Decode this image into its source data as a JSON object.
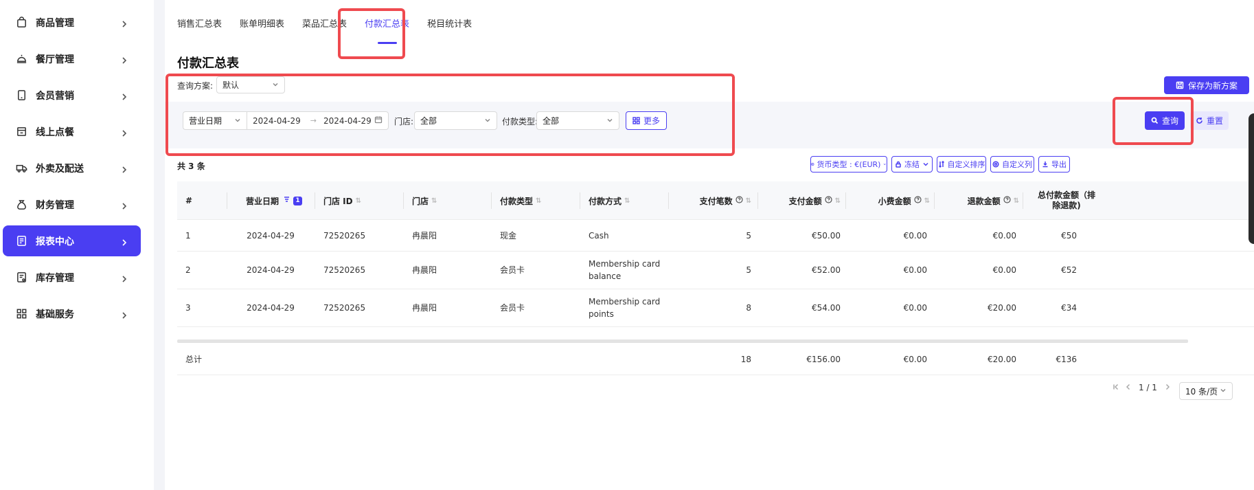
{
  "sidebar": {
    "items": [
      {
        "label": "商品管理"
      },
      {
        "label": "餐厅管理"
      },
      {
        "label": "会员营销"
      },
      {
        "label": "线上点餐"
      },
      {
        "label": "外卖及配送"
      },
      {
        "label": "财务管理"
      },
      {
        "label": "报表中心"
      },
      {
        "label": "库存管理"
      },
      {
        "label": "基础服务"
      }
    ]
  },
  "tabs": [
    {
      "label": "销售汇总表"
    },
    {
      "label": "账单明细表"
    },
    {
      "label": "菜品汇总表"
    },
    {
      "label": "付款汇总表"
    },
    {
      "label": "税目统计表"
    }
  ],
  "page": {
    "title": "付款汇总表",
    "scheme_label": "查询方案:",
    "scheme_value": "默认",
    "save_scheme": "保存为新方案"
  },
  "filters": {
    "date_type": "营业日期",
    "date_start": "2024-04-29",
    "date_end": "2024-04-29",
    "date_arrow": "→",
    "store_label": "门店:",
    "store_value": "全部",
    "pay_type_label": "付款类型:",
    "pay_type_value": "全部",
    "more": "更多",
    "query": "查询",
    "reset": "重置"
  },
  "summary": {
    "count": "共 3 条"
  },
  "toolbar": {
    "currency": "货币类型 : €(EUR)",
    "freeze": "冻结",
    "sort": "自定义排序",
    "columns": "自定义列",
    "export": "导出"
  },
  "table": {
    "headers": [
      "#",
      "营业日期",
      "门店 ID",
      "门店",
      "付款类型",
      "付款方式",
      "支付笔数",
      "支付金额",
      "小费金额",
      "退款金额",
      "总付款金额（排除退款)"
    ],
    "sort_badge": "1",
    "rows": [
      {
        "idx": "1",
        "date": "2024-04-29",
        "store_id": "72520265",
        "store": "冉晨阳",
        "pay_type": "现金",
        "pay_method_1": "Cash",
        "pay_method_2": "",
        "count": "5",
        "amount": "€50.00",
        "tip": "€0.00",
        "refund": "€0.00",
        "total": "€50"
      },
      {
        "idx": "2",
        "date": "2024-04-29",
        "store_id": "72520265",
        "store": "冉晨阳",
        "pay_type": "会员卡",
        "pay_method_1": "Membership card",
        "pay_method_2": "balance",
        "count": "5",
        "amount": "€52.00",
        "tip": "€0.00",
        "refund": "€0.00",
        "total": "€52"
      },
      {
        "idx": "3",
        "date": "2024-04-29",
        "store_id": "72520265",
        "store": "冉晨阳",
        "pay_type": "会员卡",
        "pay_method_1": "Membership card",
        "pay_method_2": "points",
        "count": "8",
        "amount": "€54.00",
        "tip": "€0.00",
        "refund": "€20.00",
        "total": "€34"
      }
    ],
    "total_row": {
      "label": "总计",
      "count": "18",
      "amount": "€156.00",
      "tip": "€0.00",
      "refund": "€20.00",
      "total": "€136"
    }
  },
  "pagination": {
    "page_info": "1 / 1",
    "page_size": "10 条/页"
  },
  "colors": {
    "accent": "#4a3ef2",
    "highlight": "#ef4a4f"
  }
}
